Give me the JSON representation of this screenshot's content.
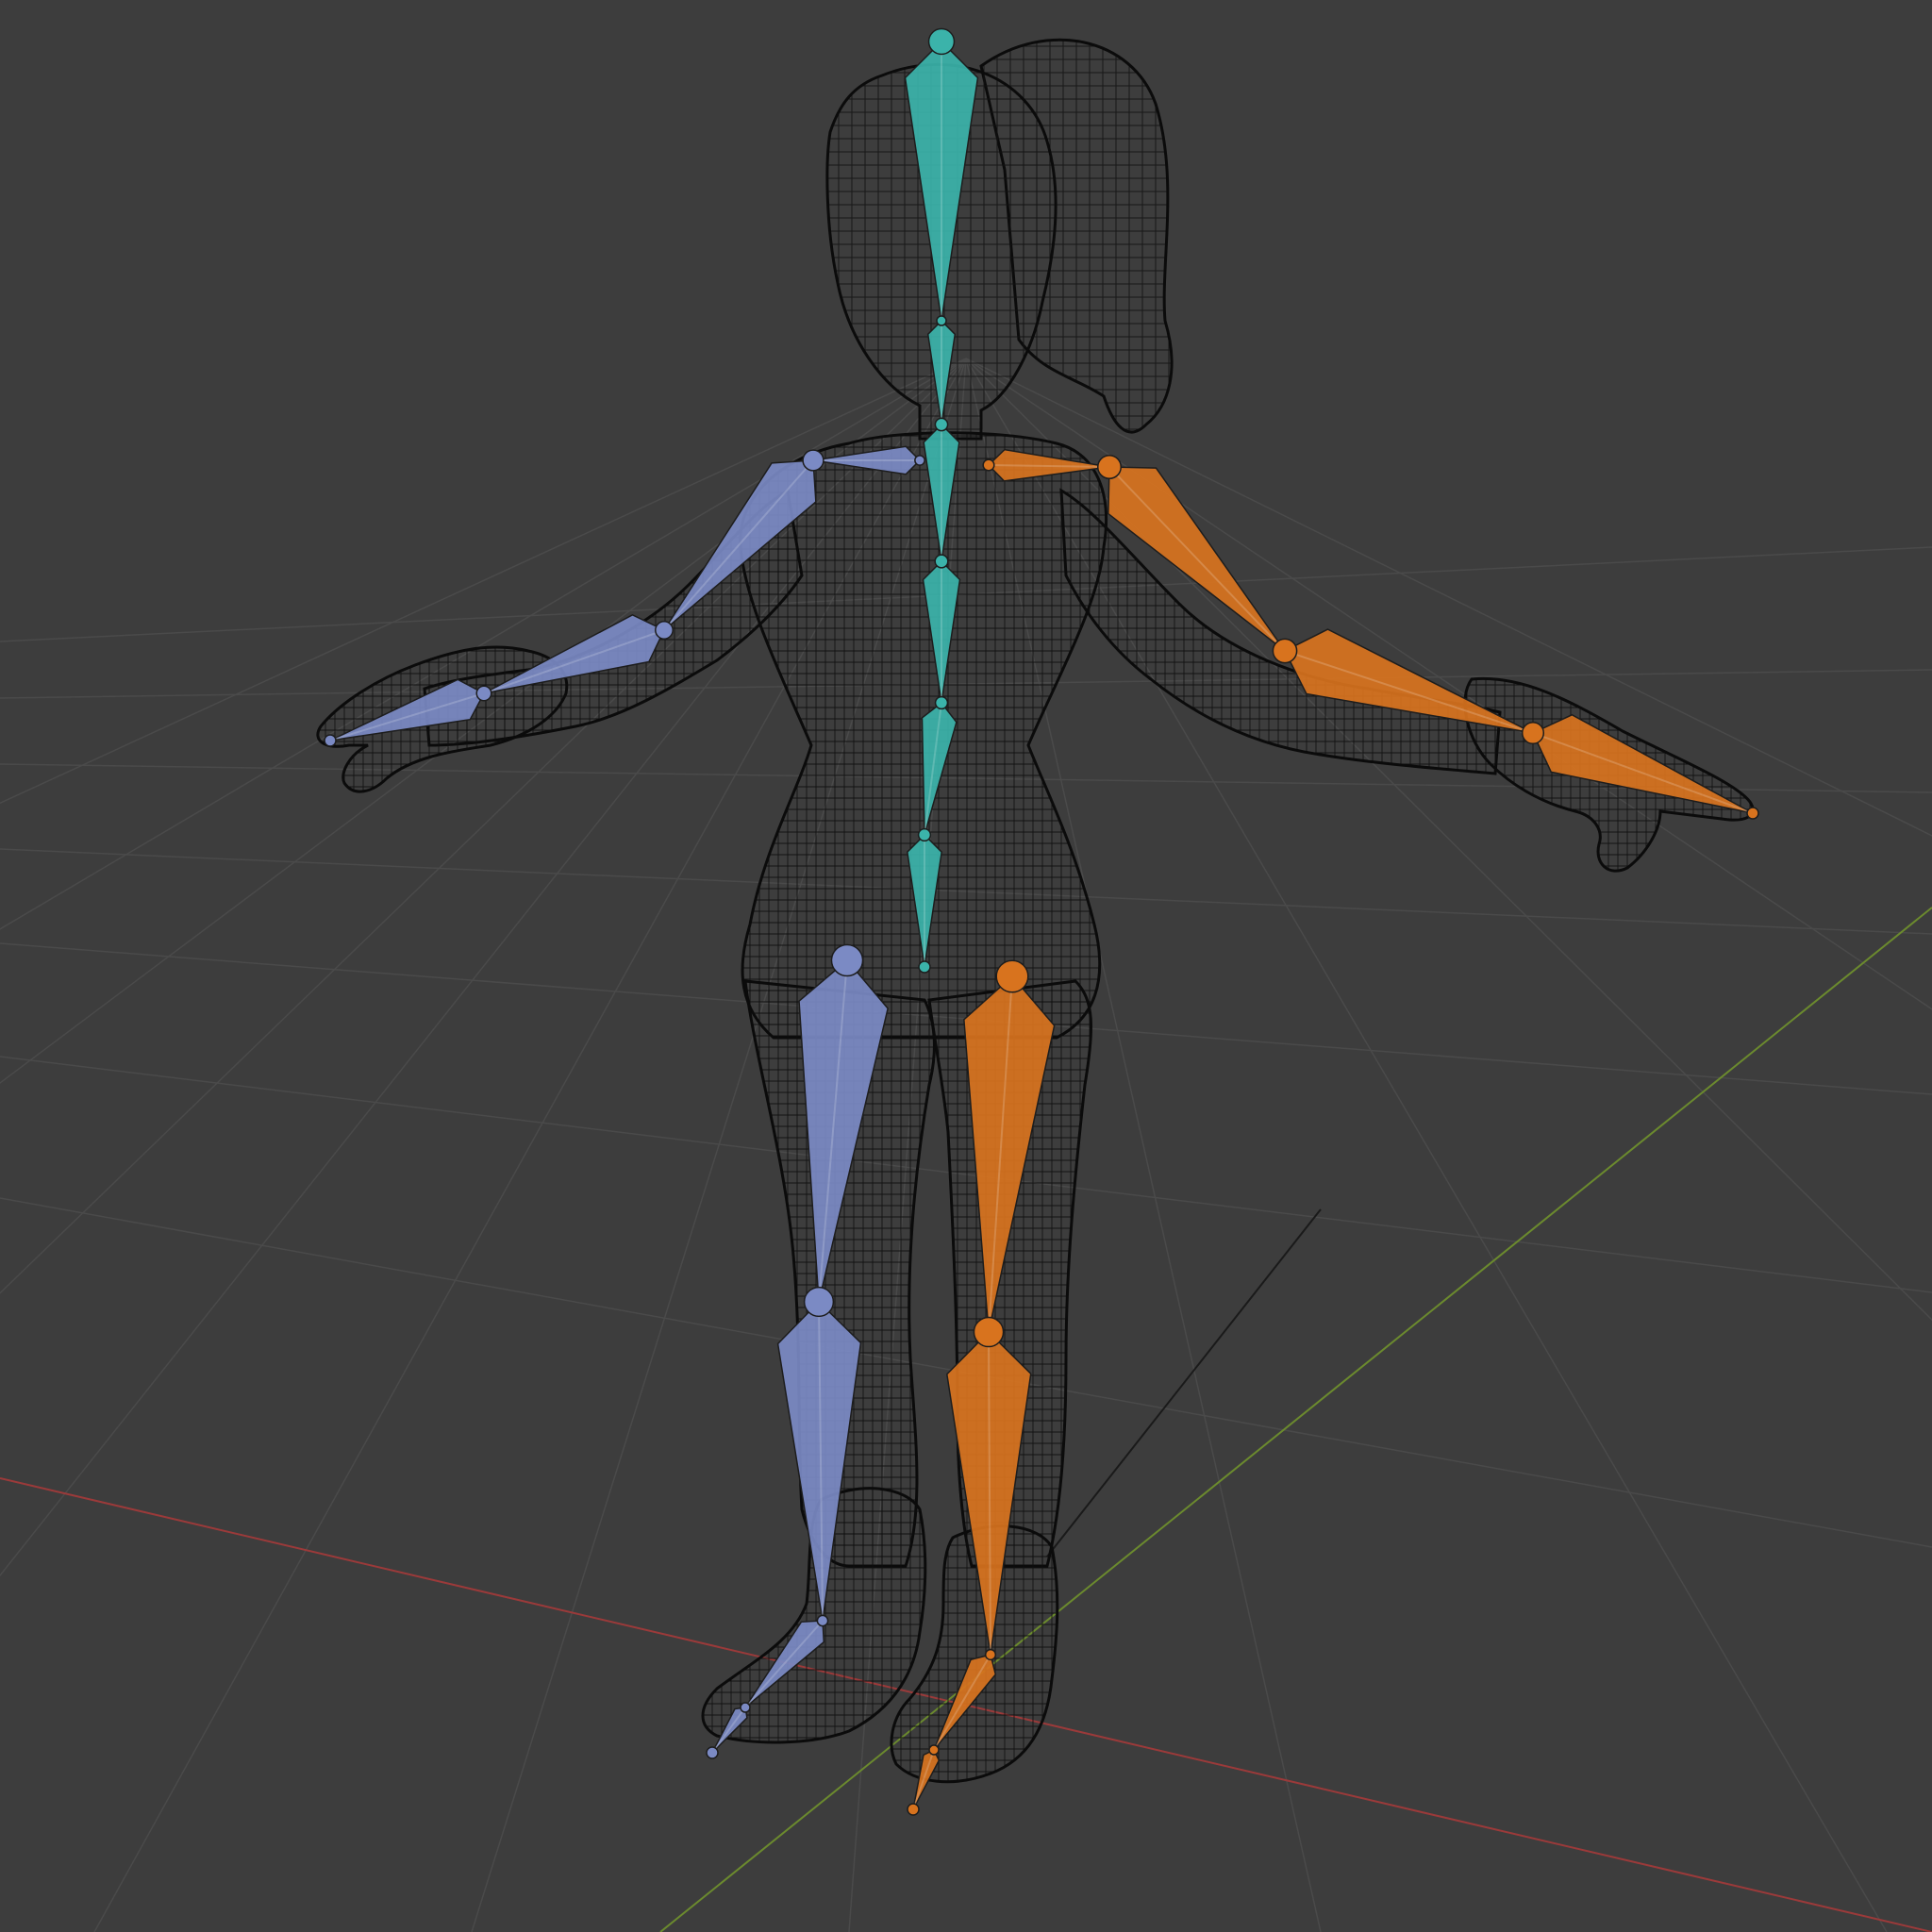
{
  "viewport": {
    "background_color": "#3d3d3d",
    "grid_line_color": "#4a4a4a",
    "x_axis_color": "#9b3a3a",
    "y_axis_color": "#6b8a2e",
    "z_axis_color": "#1a1a1a"
  },
  "mesh": {
    "name": "character-wireframe-mesh",
    "display_mode": "wireframe",
    "wire_color": "#0b0b0b",
    "fill_color": "#383838"
  },
  "armature": {
    "pose": "T-pose",
    "display_mode": "octahedral",
    "colors": {
      "center": "#3bb3aa",
      "left": "#7b8ac4",
      "right": "#d8731e"
    },
    "bone_groups": [
      {
        "name": "spine",
        "side": "center",
        "bone_count": 7
      },
      {
        "name": "left-arm",
        "side": "left",
        "bone_count": 4
      },
      {
        "name": "right-arm",
        "side": "right",
        "bone_count": 4
      },
      {
        "name": "left-leg",
        "side": "left",
        "bone_count": 4
      },
      {
        "name": "right-leg",
        "side": "right",
        "bone_count": 4
      }
    ]
  }
}
